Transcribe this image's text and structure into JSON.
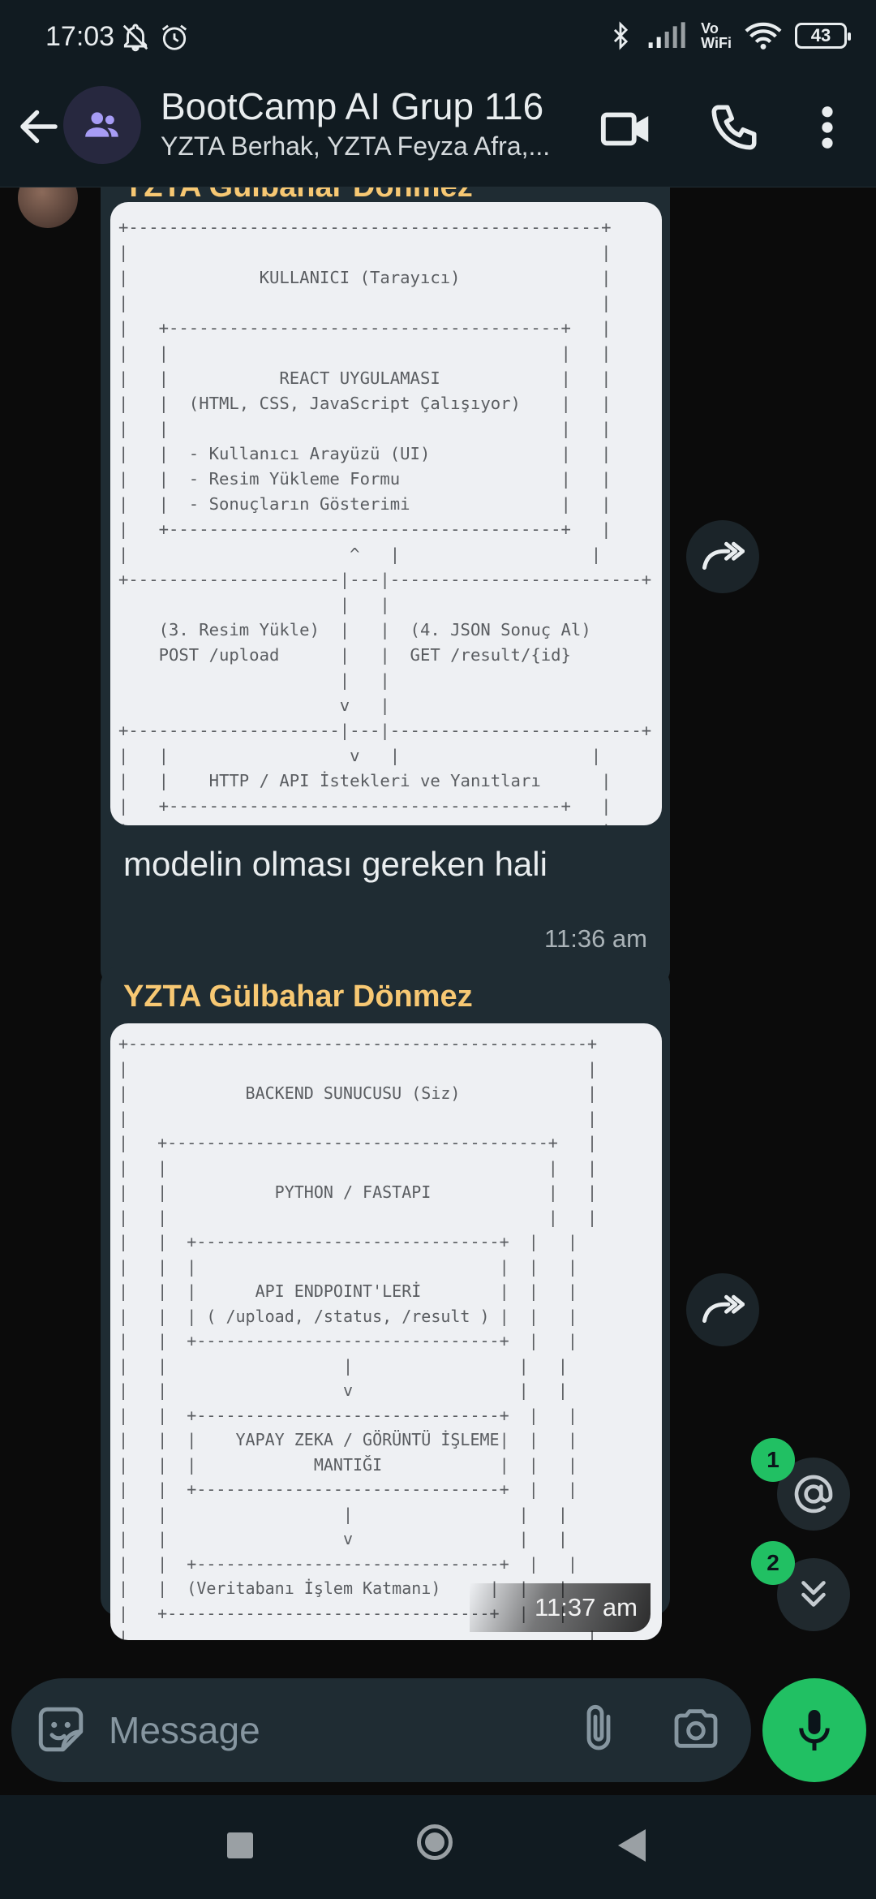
{
  "status_bar": {
    "time": "17:03",
    "volte_top": "Vo",
    "volte_bottom": "WiFi",
    "battery": "43"
  },
  "header": {
    "title": "BootCamp AI Grup 116",
    "subtitle": "YZTA Berhak, YZTA Feyza Afra,..."
  },
  "messages": [
    {
      "sender": "YZTA Gülbahar Dönmez",
      "diagram": "+-----------------------------------------------+\n|                                               |\n|             KULLANICI (Tarayıcı)              |\n|                                               |\n|   +---------------------------------------+   |\n|   |                                       |   |\n|   |           REACT UYGULAMASI            |   |\n|   |  (HTML, CSS, JavaScript Çalışıyor)    |   |\n|   |                                       |   |\n|   |  - Kullanıcı Arayüzü (UI)             |   |\n|   |  - Resim Yükleme Formu                |   |\n|   |  - Sonuçların Gösterimi               |   |\n|   +---------------------------------------+   |\n|                      ^   |                   |\n+---------------------|---|-------------------------+\n                      |   |\n    (3. Resim Yükle)  |   |  (4. JSON Sonuç Al)\n    POST /upload      |   |  GET /result/{id}\n                      |   |\n                      v   |\n+---------------------|---|-------------------------+\n|   |                  v   |                   |\n|   |    HTTP / API İstekleri ve Yanıtları      |\n|   +---------------------------------------+   |\n|                                               |\n+-----------------------------------------------+",
      "caption": "modelin olması gereken hali",
      "time": "11:36 am"
    },
    {
      "sender": "YZTA Gülbahar Dönmez",
      "diagram": "+-----------------------------------------------+\n|                                               |\n|            BACKEND SUNUCUSU (Siz)             |\n|                                               |\n|   +---------------------------------------+   |\n|   |                                       |   |\n|   |           PYTHON / FASTAPI            |   |\n|   |                                       |   |\n|   |  +-------------------------------+  |   |\n|   |  |                               |  |   |\n|   |  |      API ENDPOINT'LERİ        |  |   |\n|   |  | ( /upload, /status, /result ) |  |   |\n|   |  +-------------------------------+  |   |\n|   |                  |                 |   |\n|   |                  v                 |   |\n|   |  +-------------------------------+  |   |\n|   |  |    YAPAY ZEKA / GÖRÜNTÜ İŞLEME|  |   |\n|   |  |            MANTIĞI            |  |   |\n|   |  +-------------------------------+  |   |\n|   |                  |                 |   |\n|   |                  v                 |   |\n|   |  +-------------------------------+  |   |\n|   |  (Veritabanı İşlem Katmanı)     |  |   |\n|   +---------------------------------+  |   |\n|                                               |\n+-----------------------------------------------+",
      "time": "11:37 am"
    }
  ],
  "badges": {
    "mentions": "1",
    "unread": "2"
  },
  "composer": {
    "placeholder": "Message"
  },
  "icons": {
    "back": "arrow-left-icon",
    "group": "group-icon",
    "video": "video-camera-icon",
    "call": "phone-icon",
    "more": "more-vertical-icon",
    "forward": "forward-icon",
    "mention": "at-sign-icon",
    "scroll_down": "double-chevron-down-icon",
    "sticker": "sticker-icon",
    "attach": "paperclip-icon",
    "camera": "camera-icon",
    "mic": "microphone-icon"
  },
  "colors": {
    "sender_name": "#f7c873",
    "accent_green": "#21c063",
    "bubble": "#1f2c33",
    "background": "#0b0b0b"
  }
}
